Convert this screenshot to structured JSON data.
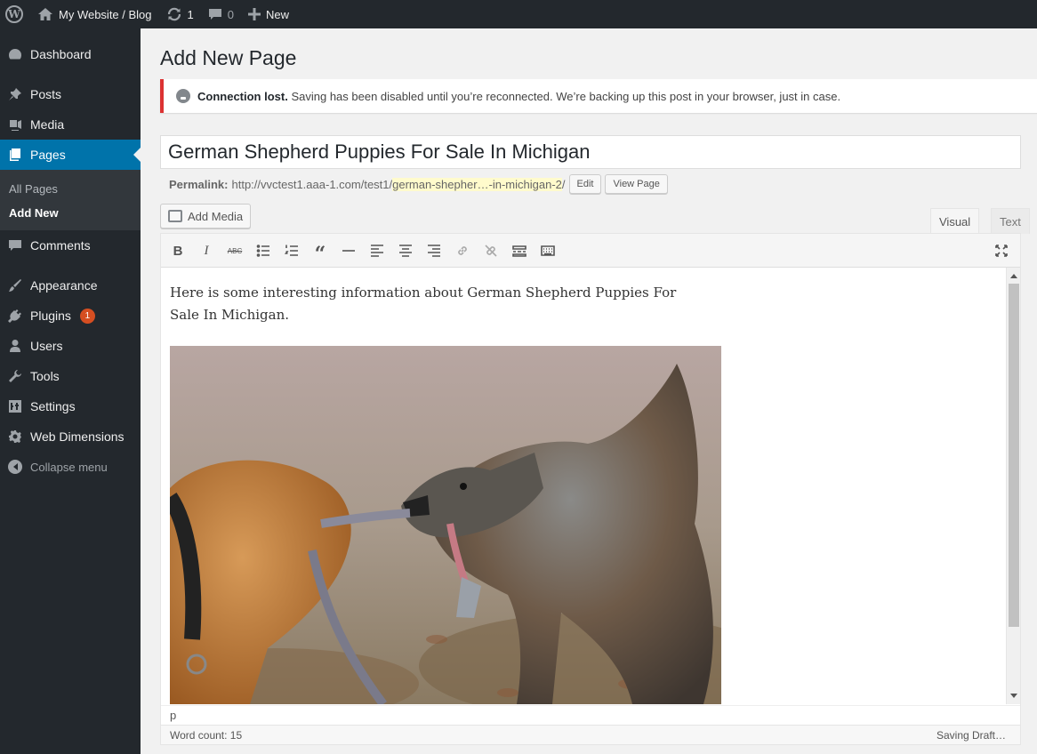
{
  "adminbar": {
    "site_name": "My Website / Blog",
    "updates_count": "1",
    "comments_count": "0",
    "new_label": "New"
  },
  "sidebar": {
    "items": [
      {
        "label": "Dashboard",
        "icon": "dashboard-icon"
      },
      {
        "label": "Posts",
        "icon": "pin-icon"
      },
      {
        "label": "Media",
        "icon": "media-icon"
      },
      {
        "label": "Pages",
        "icon": "pages-icon"
      },
      {
        "label": "Comments",
        "icon": "comment-icon"
      },
      {
        "label": "Appearance",
        "icon": "brush-icon"
      },
      {
        "label": "Plugins",
        "icon": "plug-icon"
      },
      {
        "label": "Users",
        "icon": "user-icon"
      },
      {
        "label": "Tools",
        "icon": "wrench-icon"
      },
      {
        "label": "Settings",
        "icon": "settings-icon"
      },
      {
        "label": "Web Dimensions",
        "icon": "gear-icon"
      }
    ],
    "submenu": [
      "All Pages",
      "Add New"
    ],
    "plugins_badge": "1",
    "collapse_label": "Collapse menu"
  },
  "page": {
    "heading": "Add New Page",
    "notice_bold": "Connection lost.",
    "notice_text": " Saving has been disabled until you’re reconnected. We’re backing up this post in your browser, just in case.",
    "title_value": "German Shepherd Puppies For Sale In Michigan",
    "permalink_label": "Permalink:",
    "permalink_base": "http://vvctest1.aaa-1.com/test1/",
    "permalink_slug": "german-shepher…-in-michigan-2",
    "permalink_end": "/",
    "edit_label": "Edit",
    "view_label": "View Page",
    "add_media_label": "Add Media",
    "tab_visual": "Visual",
    "tab_text": "Text"
  },
  "editor": {
    "content": "Here is some interesting information about German Shepherd Puppies For Sale In Michigan.",
    "path": "p",
    "word_count": "Word count: 15",
    "save_status": "Saving Draft…"
  }
}
